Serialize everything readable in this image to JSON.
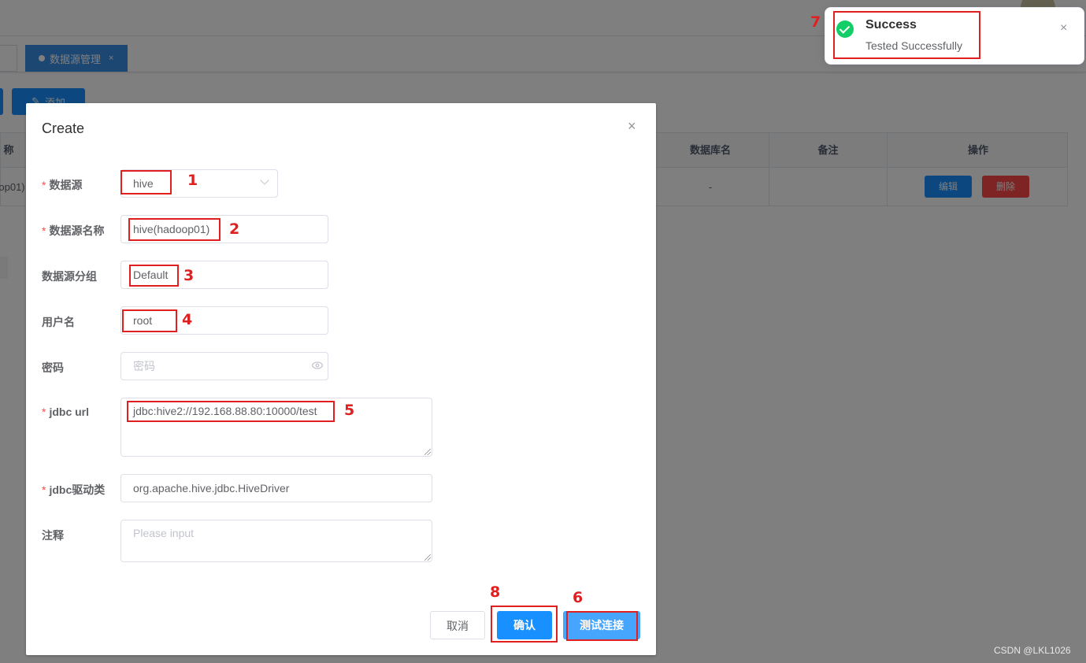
{
  "background": {
    "tag_label": "数据源管理",
    "tag_close": "×",
    "add_button": "添加",
    "table": {
      "headers": [
        "称",
        "数据库名",
        "备注",
        "操作"
      ],
      "row": {
        "name": "op01)",
        "db_name": "-",
        "remark": ""
      },
      "edit_button": "编辑",
      "delete_button": "删除"
    }
  },
  "dialog": {
    "title": "Create",
    "close": "×",
    "fields": {
      "datasource": {
        "label": "数据源",
        "value": "hive"
      },
      "datasource_name": {
        "label": "数据源名称",
        "value": "hive(hadoop01)"
      },
      "datasource_group": {
        "label": "数据源分组",
        "value": "Default"
      },
      "username": {
        "label": "用户名",
        "value": "root"
      },
      "password": {
        "label": "密码",
        "placeholder": "密码"
      },
      "jdbc_url": {
        "label": "jdbc url",
        "value": "jdbc:hive2://192.168.88.80:10000/test"
      },
      "jdbc_driver": {
        "label": "jdbc驱动类",
        "value": "org.apache.hive.jdbc.HiveDriver"
      },
      "comment": {
        "label": "注释",
        "placeholder": "Please input"
      }
    },
    "buttons": {
      "cancel": "取消",
      "confirm": "确认",
      "test": "测试连接"
    }
  },
  "notification": {
    "title": "Success",
    "message": "Tested Successfully",
    "close": "×",
    "type_color": "#13ce66"
  },
  "annotations": [
    "1",
    "2",
    "3",
    "4",
    "5",
    "6",
    "7",
    "8"
  ],
  "watermark": "CSDN @LKL1026"
}
